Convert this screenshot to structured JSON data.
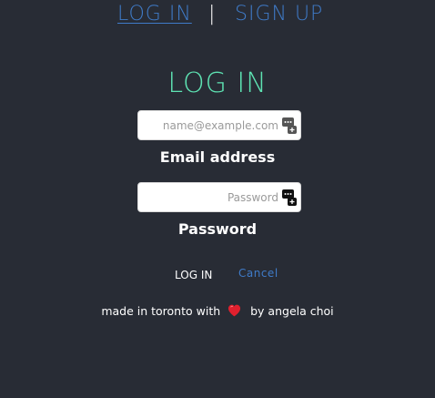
{
  "nav": {
    "login_label": "LOG IN",
    "separator": "|",
    "signup_label": "SIGN UP"
  },
  "form": {
    "title": "LOG IN",
    "email": {
      "placeholder": "name@example.com",
      "value": "",
      "label": "Email address",
      "icon": "autofill-key-icon"
    },
    "password": {
      "placeholder": "Password",
      "value": "",
      "label": "Password",
      "icon": "autofill-key-icon"
    },
    "login_button": "LOG IN",
    "cancel_link": "Cancel"
  },
  "footer": {
    "before_heart": "made in toronto with",
    "heart_icon": "heart-icon",
    "after_heart": "by angela choi"
  },
  "colors": {
    "background": "#282c35",
    "accent_green": "#5ee3b3",
    "link_blue": "#3f7bc8",
    "heart_red": "#e0202e"
  }
}
